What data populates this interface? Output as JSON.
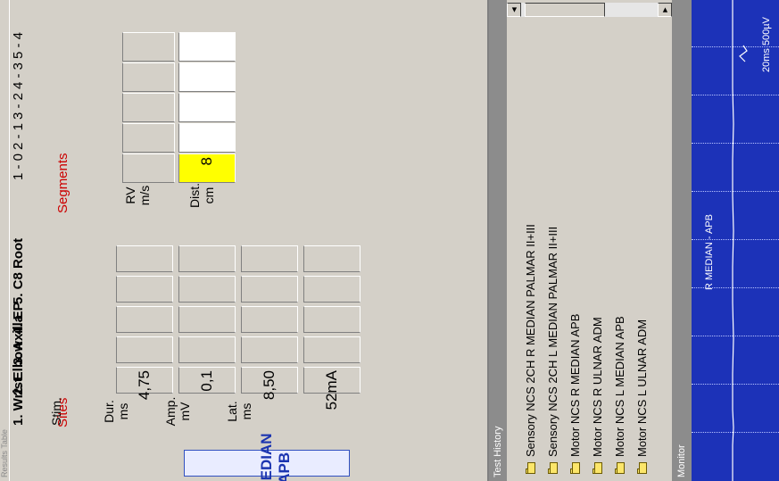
{
  "results": {
    "title": "Results Table",
    "test_name": "R MEDIAN - APB",
    "sites_heading": "Sites",
    "segments_heading": "Segments",
    "columns": {
      "lat": [
        "Lat.",
        "ms"
      ],
      "amp": [
        "Amp.",
        "mV"
      ],
      "dur": [
        "Dur.",
        "ms"
      ],
      "stim": [
        "Stim."
      ],
      "dist": [
        "Dist.",
        "cm"
      ],
      "rv": [
        "RV",
        "m/s"
      ]
    },
    "sites": [
      {
        "label": "1. Wrist",
        "lat": "4,75",
        "amp": "0,1",
        "dur": "8,50",
        "stim": "52mA"
      },
      {
        "label": "2. Elbow",
        "lat": "",
        "amp": "",
        "dur": "",
        "stim": ""
      },
      {
        "label": "3. Axilla",
        "lat": "",
        "amp": "",
        "dur": "",
        "stim": ""
      },
      {
        "label": "4. EP",
        "lat": "",
        "amp": "",
        "dur": "",
        "stim": ""
      },
      {
        "label": "5. C8 Root",
        "lat": "",
        "amp": "",
        "dur": "",
        "stim": ""
      }
    ],
    "segments": [
      {
        "label": "1 - 0",
        "dist": "8",
        "rv": ""
      },
      {
        "label": "2 - 1",
        "dist": "",
        "rv": ""
      },
      {
        "label": "3 - 2",
        "dist": "",
        "rv": ""
      },
      {
        "label": "4 - 3",
        "dist": "",
        "rv": ""
      },
      {
        "label": "5 - 4",
        "dist": "",
        "rv": ""
      }
    ]
  },
  "history": {
    "title": "Test History",
    "items": [
      "Sensory NCS 2CH R MEDIAN PALMAR II+III",
      "Sensory NCS 2CH L MEDIAN PALMAR II+III",
      "Motor NCS R MEDIAN APB",
      "Motor NCS R ULNAR ADM",
      "Motor NCS L MEDIAN APB",
      "Motor NCS L ULNAR ADM"
    ],
    "scroll_up_icon": "◄",
    "scroll_down_icon": "►"
  },
  "monitor": {
    "title": "Monitor",
    "trace_label": "R MEDIAN - APB",
    "scale": "20ms 500µV"
  },
  "colors": {
    "panel": "#d4d0c8",
    "screen": "#1c32b8",
    "highlight": "#ffff00",
    "heading_red": "#cc0000",
    "badge_text": "#1b34b0"
  }
}
